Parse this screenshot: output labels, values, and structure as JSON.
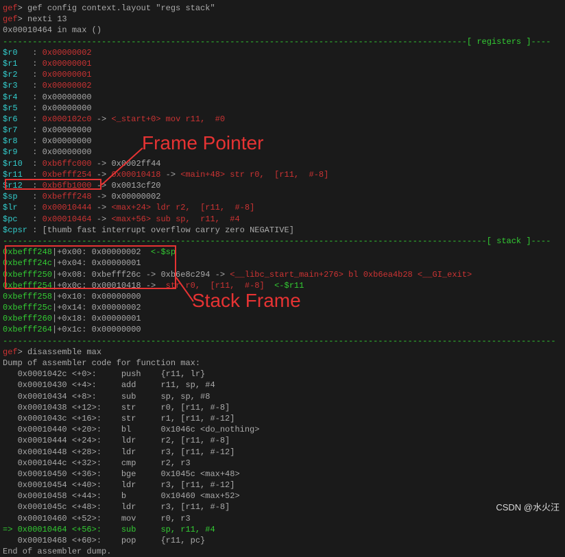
{
  "cmd1_prompt": "gef",
  "cmd1": "> gef config context.layout \"regs stack\"",
  "cmd2_prompt": "gef",
  "cmd2": "> nexti 13",
  "status": "0x00010464 in max ()",
  "sep_registers": "----------------------------------------------------------------------------------------------[ registers ]----",
  "registers": [
    {
      "name": "$r0   ",
      "sep": ": ",
      "val": "0x00000002"
    },
    {
      "name": "$r1   ",
      "sep": ": ",
      "val": "0x00000001"
    },
    {
      "name": "$r2   ",
      "sep": ": ",
      "val": "0x00000001"
    },
    {
      "name": "$r3   ",
      "sep": ": ",
      "val": "0x00000002"
    },
    {
      "name": "$r4   ",
      "sep": ": ",
      "val": "0x00000000"
    },
    {
      "name": "$r5   ",
      "sep": ": ",
      "val": "0x00000000"
    }
  ],
  "r6": {
    "name": "$r6   ",
    "sep": ": ",
    "val": "0x000102c0",
    "arrow": " -> ",
    "tail": "<_start+0> mov r11,  #0"
  },
  "r7": {
    "name": "$r7   ",
    "sep": ": ",
    "val": "0x00000000"
  },
  "r8": {
    "name": "$r8   ",
    "sep": ": ",
    "val": "0x00000000"
  },
  "r9": {
    "name": "$r9   ",
    "sep": ": ",
    "val": "0x00000000"
  },
  "r10": {
    "name": "$r10  ",
    "sep": ": ",
    "val": "0xb6ffc000",
    "arrow": " -> ",
    "tail": "0x0002ff44"
  },
  "r11": {
    "name": "$r11  ",
    "sep": ": ",
    "val": "0xbefff254",
    "arrow": " -> ",
    "mid": "0x00010418",
    "arrow2": " -> ",
    "tail": "<main+48> str r0,  [r11,  #-8]"
  },
  "r12": {
    "name": "$r12  ",
    "sep": ": ",
    "val": "0xb6fb1000",
    "arrow": " -> ",
    "tail": "0x0013cf20"
  },
  "sp": {
    "name": "$sp   ",
    "sep": ": ",
    "val": "0xbefff248",
    "arrow": " -> ",
    "tail": "0x00000002"
  },
  "lr": {
    "name": "$lr   ",
    "sep": ": ",
    "val": "0x00010444",
    "arrow": " -> ",
    "tail": "<max+24> ldr r2,  [r11,  #-8]"
  },
  "pc": {
    "name": "$pc   ",
    "sep": ": ",
    "val": "0x00010464",
    "arrow": " -> ",
    "tail": "<max+56> sub sp,  r11,  #4"
  },
  "cpsr": {
    "name": "$cpsr ",
    "sep": ": ",
    "open": "[",
    "flags": "thumb fast interrupt overflow carry zero NEGATIVE",
    "close": "]"
  },
  "sep_stack": "--------------------------------------------------------------------------------------------------[ stack ]----",
  "stack": [
    {
      "addr": "0xbefff248",
      "off": "|+0x00: ",
      "val": "0x00000002",
      "tail_g": "  <-$sp"
    },
    {
      "addr": "0xbefff24c",
      "off": "|+0x04: ",
      "val": "0x00000001"
    },
    {
      "addr": "0xbefff250",
      "off": "|+0x08: ",
      "val": "0xbefff26c",
      "arrow": " -> ",
      "mid": "0xb6e8c294",
      "arrow2": " -> ",
      "red1": "<__libc_start_main+276> bl 0xb6ea4b28 <__GI_exit>"
    },
    {
      "addr": "0xbefff254",
      "off": "|+0x0c: ",
      "val": "0x00010418",
      "arrow": " -> ",
      "red1": "<main+48> str r0,  [r11,  #-8]",
      "tail_g": "  <-$r11"
    },
    {
      "addr": "0xbefff258",
      "off": "|+0x10: ",
      "val": "0x00000000"
    },
    {
      "addr": "0xbefff25c",
      "off": "|+0x14: ",
      "val": "0x00000002"
    },
    {
      "addr": "0xbefff260",
      "off": "|+0x18: ",
      "val": "0x00000001"
    },
    {
      "addr": "0xbefff264",
      "off": "|+0x1c: ",
      "val": "0x00000000"
    }
  ],
  "sep_bottom": "----------------------------------------------------------------------------------------------------------------",
  "cmd3_prompt": "gef",
  "cmd3": "> disassemble max",
  "dump_hdr": "Dump of assembler code for function max:",
  "asm": [
    "   0x0001042c <+0>:     push    {r11, lr}",
    "   0x00010430 <+4>:     add     r11, sp, #4",
    "   0x00010434 <+8>:     sub     sp, sp, #8",
    "   0x00010438 <+12>:    str     r0, [r11, #-8]",
    "   0x0001043c <+16>:    str     r1, [r11, #-12]",
    "   0x00010440 <+20>:    bl      0x1046c <do_nothing>",
    "   0x00010444 <+24>:    ldr     r2, [r11, #-8]",
    "   0x00010448 <+28>:    ldr     r3, [r11, #-12]",
    "   0x0001044c <+32>:    cmp     r2, r3",
    "   0x00010450 <+36>:    bge     0x1045c <max+48>",
    "   0x00010454 <+40>:    ldr     r3, [r11, #-12]",
    "   0x00010458 <+44>:    b       0x10460 <max+52>",
    "   0x0001045c <+48>:    ldr     r3, [r11, #-8]",
    "   0x00010460 <+52>:    mov     r0, r3"
  ],
  "asm_cur": "=> 0x00010464 <+56>:    sub     sp, r11, #4",
  "asm_tail": "   0x00010468 <+60>:    pop     {r11, pc}",
  "dump_end": "End of assembler dump.",
  "anno_fp": "Frame Pointer",
  "anno_sf": "Stack Frame",
  "watermark": "CSDN @水火汪"
}
